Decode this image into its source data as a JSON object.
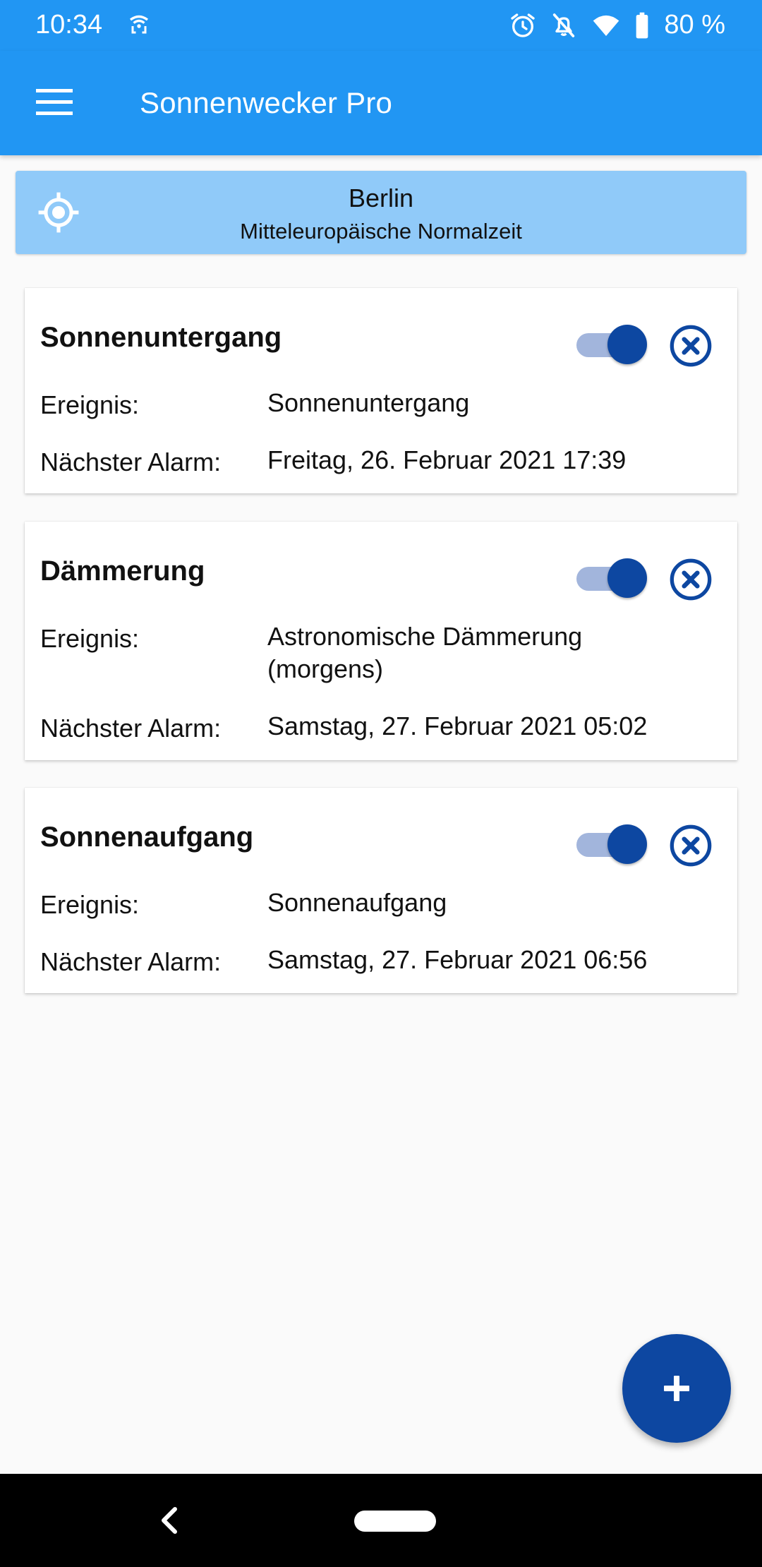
{
  "status_bar": {
    "time": "10:34",
    "battery_percent": "80 %",
    "notification_icon": "wifi-call-icon",
    "icons": [
      "alarm-clock-icon",
      "bell-off-icon",
      "wifi-icon",
      "battery-icon"
    ]
  },
  "app_bar": {
    "title": "Sonnenwecker Pro",
    "menu_icon": "hamburger-menu-icon"
  },
  "location": {
    "city": "Berlin",
    "timezone": "Mitteleuropäische Normalzeit",
    "icon": "gps-target-icon"
  },
  "alarms": [
    {
      "title": "Sonnenuntergang",
      "enabled": true,
      "event_label": "Ereignis:",
      "event": "Sonnenuntergang",
      "next_label": "Nächster Alarm:",
      "next": "Freitag, 26. Februar 2021 17:39"
    },
    {
      "title": "Dämmerung",
      "enabled": true,
      "event_label": "Ereignis:",
      "event": "Astronomische Dämmerung (morgens)",
      "next_label": "Nächster Alarm:",
      "next": "Samstag, 27. Februar 2021 05:02"
    },
    {
      "title": "Sonnenaufgang",
      "enabled": true,
      "event_label": "Ereignis:",
      "event": "Sonnenaufgang",
      "next_label": "Nächster Alarm:",
      "next": "Samstag, 27. Februar 2021 06:56"
    }
  ],
  "colors": {
    "primary": "#2196f3",
    "location_bar": "#90caf9",
    "accent": "#0d47a1",
    "switch_track": "#a2b5dc"
  },
  "fab": {
    "icon": "plus-icon"
  }
}
